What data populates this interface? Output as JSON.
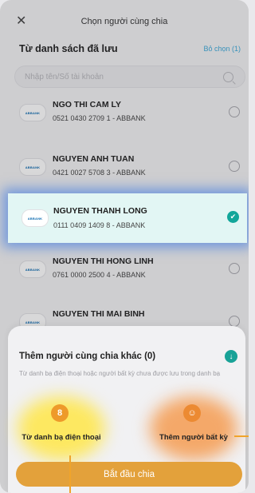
{
  "header": {
    "title": "Chọn người cùng chia"
  },
  "saved_section": {
    "title": "Từ danh sách đã lưu",
    "unselect_label": "Bỏ chọn (1)"
  },
  "search": {
    "placeholder": "Nhập tên/Số tài khoản"
  },
  "bank_logo_text": "ABBANK",
  "contacts": [
    {
      "name": "NGO THI CAM LY",
      "account": "0521 0430 2709 1 - ABBANK",
      "selected": false
    },
    {
      "name": "NGUYEN ANH TUAN",
      "account": "0421 0027 5708 3 - ABBANK",
      "selected": false
    },
    {
      "name": "NGUYEN THANH LONG",
      "account": "0111 0409 1409 8 - ABBANK",
      "selected": true
    },
    {
      "name": "NGUYEN THI HONG LINH",
      "account": "0761 0000 2500 4 - ABBANK",
      "selected": false
    },
    {
      "name": "NGUYEN THI MAI BINH",
      "account": "",
      "selected": false
    }
  ],
  "add_section": {
    "title": "Thêm người cùng chia khác (0)",
    "description": "Từ danh bạ điện thoại hoặc người bất kỳ chưa được lưu trong danh bạ",
    "option_phonebook": "Từ danh bạ điện thoại",
    "option_anyone": "Thêm người bất kỳ"
  },
  "start_button": {
    "label": "Bắt đầu chia"
  },
  "colors": {
    "accent": "#12a69a",
    "link": "#3ba9d9",
    "button": "#e3a13b",
    "selected_bg": "#e2f6f4"
  }
}
